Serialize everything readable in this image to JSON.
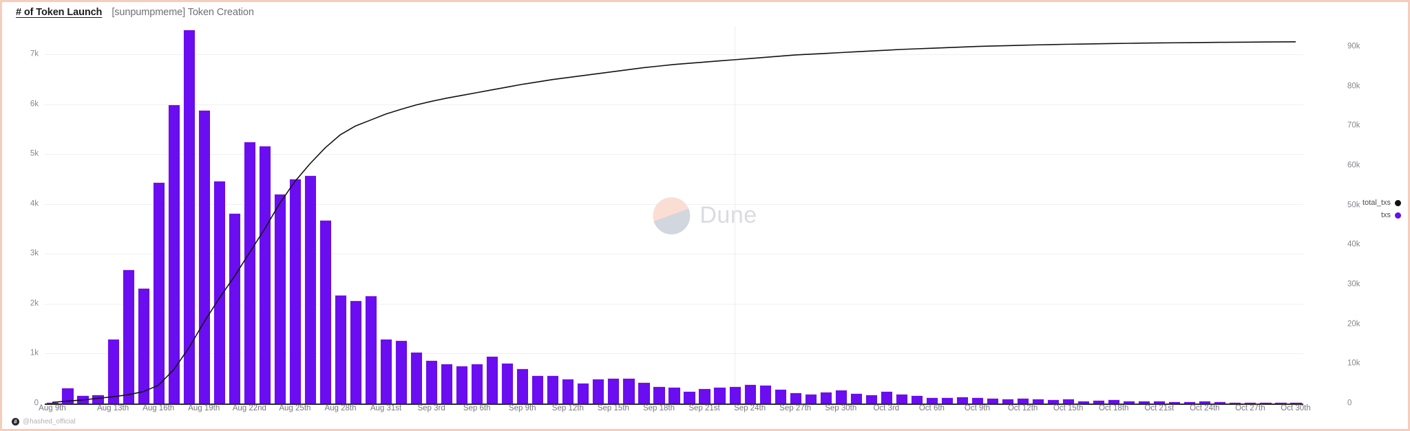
{
  "header": {
    "title": "# of Token Launch",
    "subtitle": "[sunpumpmeme] Token Creation"
  },
  "watermark": {
    "text": "Dune",
    "mark_icon": "dune-logo-icon"
  },
  "footer": {
    "handle": "@hashed_official",
    "avatar_icon": "avatar-icon"
  },
  "legend": {
    "position": "right",
    "items": [
      {
        "label": "total_txs",
        "color": "#111111",
        "icon": "legend-dot-icon"
      },
      {
        "label": "txs",
        "color": "#6a0df0",
        "icon": "legend-dot-icon"
      }
    ]
  },
  "axes": {
    "left": {
      "ticks": [
        "0",
        "1k",
        "2k",
        "3k",
        "4k",
        "5k",
        "6k",
        "7k"
      ],
      "values": [
        0,
        1000,
        2000,
        3000,
        4000,
        5000,
        6000,
        7000
      ],
      "min": 0,
      "max": 7550
    },
    "right": {
      "ticks": [
        "0",
        "10k",
        "20k",
        "30k",
        "40k",
        "50k",
        "60k",
        "70k",
        "80k",
        "90k"
      ],
      "values": [
        0,
        10000,
        20000,
        30000,
        40000,
        50000,
        60000,
        70000,
        80000,
        90000
      ],
      "min": 0,
      "max": 95000
    },
    "x": {
      "ticks": [
        "Aug 9th",
        "Aug 13th",
        "Aug 16th",
        "Aug 19th",
        "Aug 22nd",
        "Aug 25th",
        "Aug 28th",
        "Aug 31st",
        "Sep 3rd",
        "Sep 6th",
        "Sep 9th",
        "Sep 12th",
        "Sep 15th",
        "Sep 18th",
        "Sep 21st",
        "Sep 24th",
        "Sep 27th",
        "Sep 30th",
        "Oct 3rd",
        "Oct 6th",
        "Oct 9th",
        "Oct 12th",
        "Oct 15th",
        "Oct 18th",
        "Oct 21st",
        "Oct 24th",
        "Oct 27th",
        "Oct 30th"
      ],
      "tick_indices": [
        0,
        4,
        7,
        10,
        13,
        16,
        19,
        22,
        25,
        28,
        31,
        34,
        37,
        40,
        43,
        46,
        49,
        52,
        55,
        58,
        61,
        64,
        67,
        70,
        73,
        76,
        79,
        82
      ]
    }
  },
  "chart_data": {
    "type": "bar",
    "title": "# of Token Launch",
    "subtitle": "[sunpumpmeme] Token Creation",
    "xlabel": "",
    "ylabel": "",
    "grid": true,
    "legend_position": "right",
    "ylim": [
      0,
      7550
    ],
    "y2lim": [
      0,
      95000
    ],
    "x": [
      "Aug 9th",
      "Aug 10th",
      "Aug 11th",
      "Aug 12th",
      "Aug 13th",
      "Aug 14th",
      "Aug 15th",
      "Aug 16th",
      "Aug 17th",
      "Aug 18th",
      "Aug 19th",
      "Aug 20th",
      "Aug 21st",
      "Aug 22nd",
      "Aug 23rd",
      "Aug 24th",
      "Aug 25th",
      "Aug 26th",
      "Aug 27th",
      "Aug 28th",
      "Aug 29th",
      "Aug 30th",
      "Aug 31st",
      "Sep 1st",
      "Sep 2nd",
      "Sep 3rd",
      "Sep 4th",
      "Sep 5th",
      "Sep 6th",
      "Sep 7th",
      "Sep 8th",
      "Sep 9th",
      "Sep 10th",
      "Sep 11th",
      "Sep 12th",
      "Sep 13th",
      "Sep 14th",
      "Sep 15th",
      "Sep 16th",
      "Sep 17th",
      "Sep 18th",
      "Sep 19th",
      "Sep 20th",
      "Sep 21st",
      "Sep 22nd",
      "Sep 23rd",
      "Sep 24th",
      "Sep 25th",
      "Sep 26th",
      "Sep 27th",
      "Sep 28th",
      "Sep 29th",
      "Sep 30th",
      "Oct 1st",
      "Oct 2nd",
      "Oct 3rd",
      "Oct 4th",
      "Oct 5th",
      "Oct 6th",
      "Oct 7th",
      "Oct 8th",
      "Oct 9th",
      "Oct 10th",
      "Oct 11th",
      "Oct 12th",
      "Oct 13th",
      "Oct 14th",
      "Oct 15th",
      "Oct 16th",
      "Oct 17th",
      "Oct 18th",
      "Oct 19th",
      "Oct 20th",
      "Oct 21st",
      "Oct 22nd",
      "Oct 23rd",
      "Oct 24th",
      "Oct 25th",
      "Oct 26th",
      "Oct 27th",
      "Oct 28th",
      "Oct 29th",
      "Oct 30th"
    ],
    "series": [
      {
        "name": "txs",
        "kind": "bar",
        "axis": "left",
        "color": "#6a0df0",
        "values": [
          30,
          320,
          170,
          180,
          1290,
          2680,
          2320,
          4440,
          6000,
          7490,
          5880,
          4470,
          3810,
          5250,
          5160,
          4200,
          4500,
          4580,
          3680,
          2180,
          2070,
          2170,
          1290,
          1270,
          1030,
          870,
          800,
          760,
          800,
          950,
          810,
          700,
          570,
          560,
          490,
          420,
          500,
          510,
          510,
          430,
          340,
          330,
          250,
          300,
          330,
          340,
          380,
          370,
          290,
          220,
          190,
          240,
          280,
          210,
          180,
          250,
          190,
          170,
          130,
          120,
          140,
          130,
          110,
          100,
          110,
          90,
          80,
          90,
          60,
          70,
          80,
          60,
          50,
          50,
          40,
          40,
          50,
          40,
          30,
          30,
          30,
          30,
          25
        ]
      },
      {
        "name": "total_txs",
        "kind": "line",
        "axis": "right",
        "color": "#111111",
        "values": [
          300,
          600,
          900,
          1300,
          1700,
          2200,
          3000,
          4600,
          8500,
          14000,
          20500,
          26500,
          32000,
          38000,
          44000,
          50500,
          56000,
          60500,
          64500,
          67800,
          70000,
          71500,
          73000,
          74200,
          75300,
          76200,
          77000,
          77700,
          78400,
          79100,
          79800,
          80500,
          81100,
          81700,
          82200,
          82700,
          83200,
          83700,
          84200,
          84700,
          85100,
          85500,
          85800,
          86100,
          86400,
          86700,
          87000,
          87300,
          87600,
          87900,
          88100,
          88300,
          88500,
          88700,
          88900,
          89100,
          89300,
          89450,
          89600,
          89750,
          89900,
          90050,
          90150,
          90250,
          90350,
          90450,
          90520,
          90600,
          90660,
          90720,
          90790,
          90840,
          90890,
          90930,
          90970,
          91010,
          91050,
          91080,
          91110,
          91140,
          91170,
          91200,
          91220
        ]
      }
    ]
  }
}
